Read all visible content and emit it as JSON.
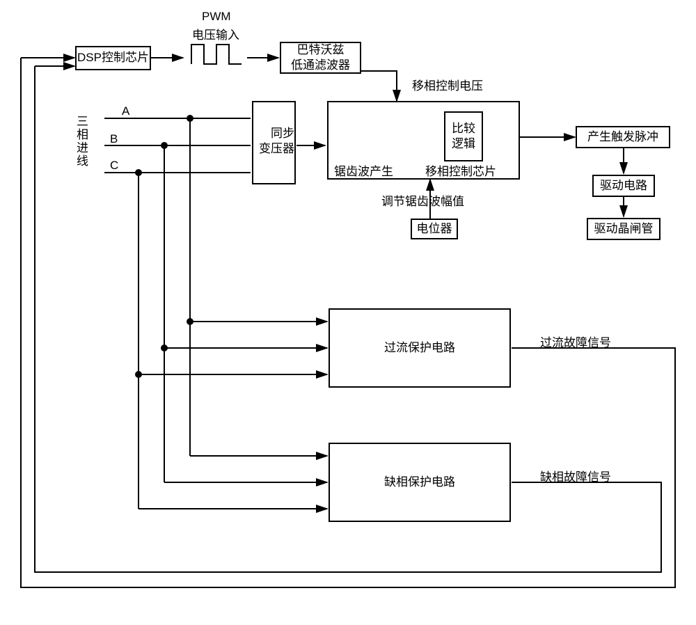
{
  "blocks": {
    "dsp": "DSP控制芯片",
    "pwm_title": "PWM",
    "pwm_sub": "电压输入",
    "butter1": "巴特沃兹",
    "butter2": "低通滤波器",
    "sync1": "同步",
    "sync2": "变压器",
    "phase_label": "移相控制电压",
    "compare": "比较\n逻辑",
    "saw": "锯齿波产生",
    "phase_chip": "移相控制芯片",
    "saw_adj": "调节锯齿波幅值",
    "pot": "电位器",
    "trigger": "产生触发脉冲",
    "drive_ckt": "驱动电路",
    "drive_scr": "驱动晶闸管",
    "oc": "过流保护电路",
    "oc_sig": "过流故障信号",
    "pl": "缺相保护电路",
    "pl_sig": "缺相故障信号",
    "three_phase": "三相进线",
    "A": "A",
    "B": "B",
    "C": "C"
  }
}
